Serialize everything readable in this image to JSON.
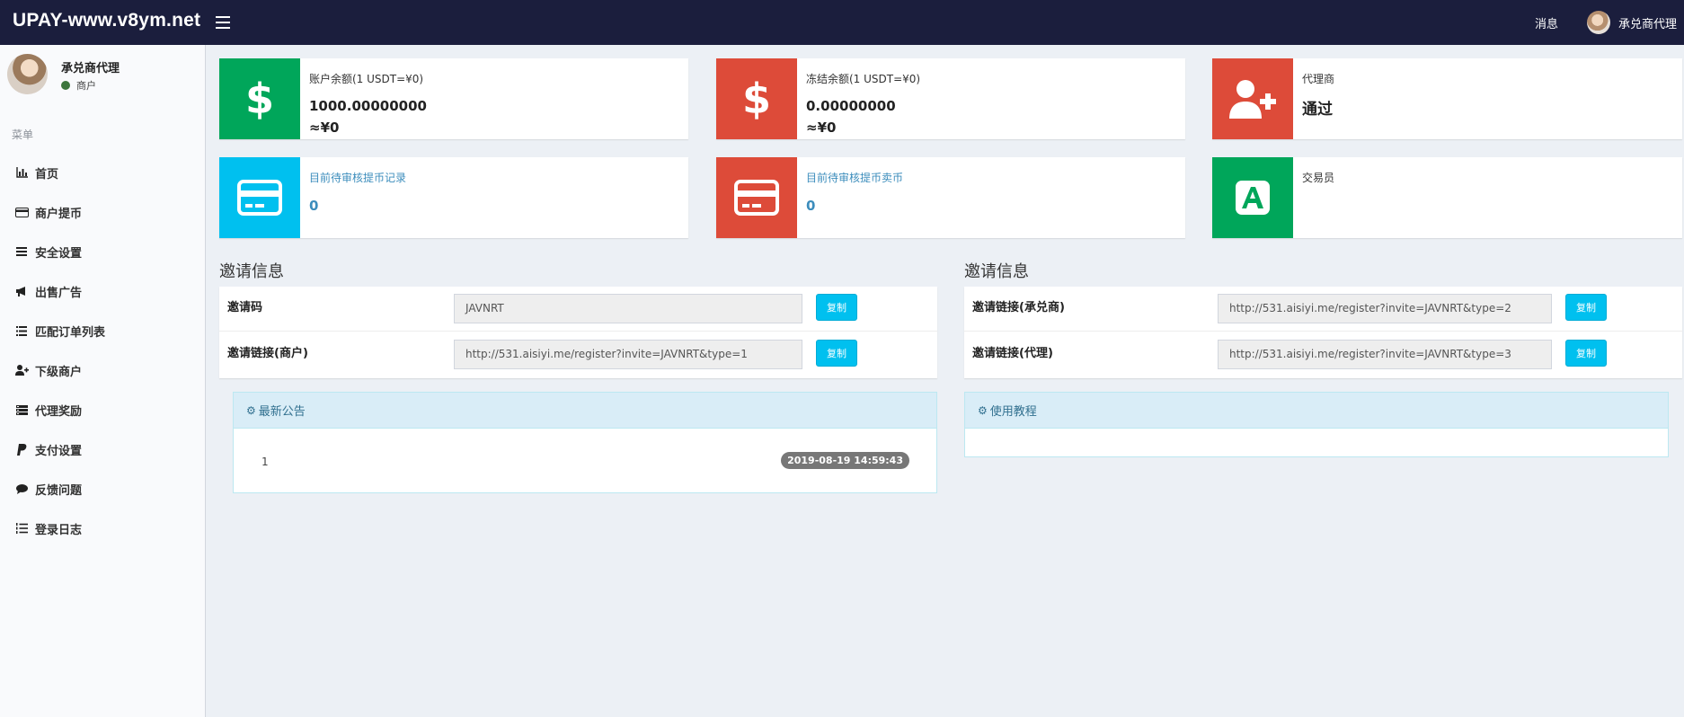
{
  "app": {
    "title": "UPAY-www.v8ym.net"
  },
  "header": {
    "messages": "消息",
    "username": "承兑商代理"
  },
  "sidebar": {
    "user_name": "承兑商代理",
    "user_status": "商户",
    "menu_header": "菜单",
    "items": [
      {
        "label": "首页",
        "icon": "bar-chart-icon"
      },
      {
        "label": "商户提币",
        "icon": "credit-card-icon"
      },
      {
        "label": "安全设置",
        "icon": "list-icon"
      },
      {
        "label": "出售广告",
        "icon": "bullhorn-icon"
      },
      {
        "label": "匹配订单列表",
        "icon": "list-alt-icon"
      },
      {
        "label": "下级商户",
        "icon": "user-plus-icon"
      },
      {
        "label": "代理奖励",
        "icon": "server-icon"
      },
      {
        "label": "支付设置",
        "icon": "paypal-icon"
      },
      {
        "label": "反馈问题",
        "icon": "comment-icon"
      },
      {
        "label": "登录日志",
        "icon": "list-ol-icon"
      }
    ]
  },
  "info_boxes": {
    "balance": {
      "title": "账户余额(1 USDT=¥0)",
      "value": "1000.00000000",
      "cny": "≈¥0"
    },
    "frozen": {
      "title": "冻结余额(1 USDT=¥0)",
      "value": "0.00000000",
      "cny": "≈¥0"
    },
    "agent": {
      "title": "代理商",
      "value": "通过"
    },
    "pending_withdraw": {
      "title": "目前待审核提币记录",
      "value": "0"
    },
    "pending_sell": {
      "title": "目前待审核提币卖币",
      "value": "0"
    },
    "trader": {
      "title": "交易员"
    }
  },
  "invite_left": {
    "title": "邀请信息",
    "rows": [
      {
        "label": "邀请码",
        "value": "JAVNRT",
        "button": "复制"
      },
      {
        "label": "邀请链接(商户)",
        "value": "http://531.aisiyi.me/register?invite=JAVNRT&type=1",
        "button": "复制"
      }
    ]
  },
  "invite_right": {
    "title": "邀请信息",
    "rows": [
      {
        "label": "邀请链接(承兑商)",
        "value": "http://531.aisiyi.me/register?invite=JAVNRT&type=2",
        "button": "复制"
      },
      {
        "label": "邀请链接(代理)",
        "value": "http://531.aisiyi.me/register?invite=JAVNRT&type=3",
        "button": "复制"
      }
    ]
  },
  "announcements": {
    "title": "最新公告",
    "items": [
      {
        "index": "1",
        "date": "2019-08-19 14:59:43"
      }
    ]
  },
  "tutorial": {
    "title": "使用教程"
  }
}
